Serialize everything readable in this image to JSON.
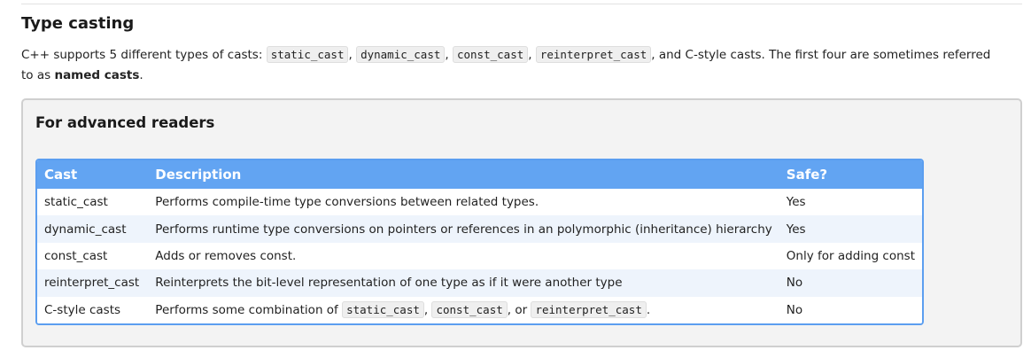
{
  "section": {
    "heading": "Type casting",
    "intro": {
      "prefix": "C++ supports 5 different types of casts: ",
      "casts": [
        "static_cast",
        "dynamic_cast",
        "const_cast",
        "reinterpret_cast"
      ],
      "sep1": ", ",
      "sep2": ", ",
      "sep3": ", ",
      "suffix": ", and C-style casts. The first four are sometimes referred to as ",
      "bold_term": "named casts",
      "end": "."
    }
  },
  "advanced": {
    "title": "For advanced readers",
    "table": {
      "headers": [
        "Cast",
        "Description",
        "Safe?"
      ],
      "rows": [
        {
          "cast": "static_cast",
          "description": "Performs compile-time type conversions between related types.",
          "safe": "Yes"
        },
        {
          "cast": "dynamic_cast",
          "description": "Performs runtime type conversions on pointers or references in an polymorphic (inheritance) hierarchy",
          "safe": "Yes"
        },
        {
          "cast": "const_cast",
          "description": "Adds or removes const.",
          "safe": "Only for adding const"
        },
        {
          "cast": "reinterpret_cast",
          "description": "Reinterprets the bit-level representation of one type as if it were another type",
          "safe": "No"
        },
        {
          "cast": "C-style casts",
          "description_prefix": "Performs some combination of ",
          "description_codes": [
            "static_cast",
            "const_cast",
            "reinterpret_cast"
          ],
          "description_sep1": ", ",
          "description_sep2": ", or ",
          "description_end": ".",
          "safe": "No"
        }
      ]
    }
  },
  "colors": {
    "table_header": "#62a4f2",
    "table_border": "#5b9ef0",
    "box_background": "#f3f3f3",
    "box_border": "#cfcfcf",
    "alt_row": "#eef4fc"
  }
}
